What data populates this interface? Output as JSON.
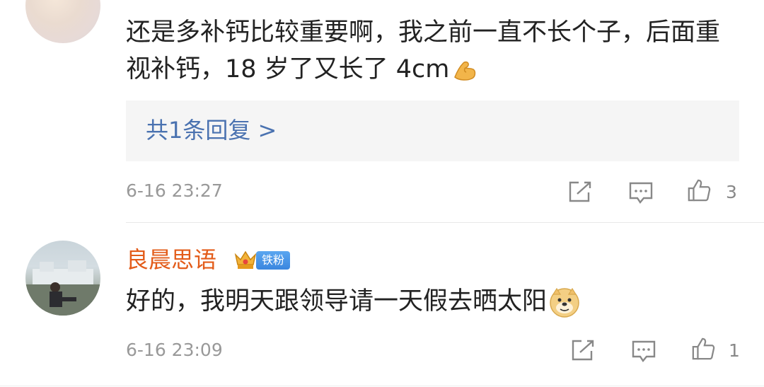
{
  "comments": [
    {
      "text": "还是多补钙比较重要啊，我之前一直不长个子，后面重视补钙，18 岁了又长了 4cm",
      "emoji": "flexed-biceps-icon",
      "replies_link": "共1条回复 >",
      "time": "6-16 23:27",
      "likes": "3"
    },
    {
      "username": "良晨思语",
      "badge": "铁粉",
      "text": "好的，我明天跟领导请一天假去晒太阳",
      "emoji": "doge-emoji-icon",
      "time": "6-16 23:09",
      "likes": "1"
    }
  ],
  "colors": {
    "username": "#e35c1a",
    "link": "#4a72b0",
    "meta": "#999999",
    "badge": "#3a86df"
  }
}
